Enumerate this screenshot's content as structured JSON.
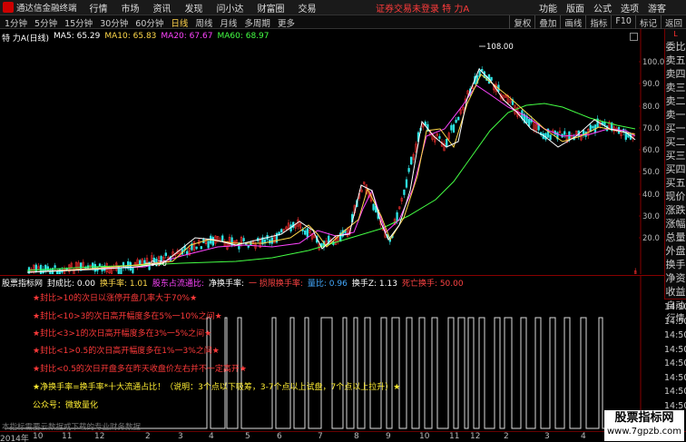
{
  "menubar": {
    "app_name": "通达信金融终端",
    "items": [
      "行情",
      "市场",
      "资讯",
      "发现",
      "问小达",
      "财富圈",
      "交易"
    ],
    "warning": "证券交易未登录  特 力A",
    "right_items": [
      "功能",
      "版面",
      "公式",
      "选项",
      "游客"
    ]
  },
  "toolbar": {
    "periods": [
      "1分钟",
      "5分钟",
      "15分钟",
      "30分钟",
      "60分钟",
      "日线",
      "周线",
      "月线",
      "多周期",
      "更多"
    ],
    "active_period": "日线",
    "right_buttons": [
      "复权",
      "叠加",
      "画线",
      "指标",
      "F10",
      "标记",
      "返回"
    ]
  },
  "main_chart": {
    "title": "特 力A(日线)",
    "ma5": "MA5: 65.29",
    "ma10": "MA10: 65.83",
    "ma20": "MA20: 67.67",
    "ma60": "MA60: 68.97",
    "high_label": "108.00",
    "low_label": "9.70",
    "y_ticks": [
      "100.0",
      "90.0",
      "80.0",
      "70.0",
      "60.0",
      "50.0",
      "40.0",
      "30.0",
      "20.0"
    ],
    "colors": {
      "ma5": "#ffffff",
      "ma10": "#ffd84a",
      "ma20": "#ff44ff",
      "ma60": "#44ff44"
    }
  },
  "right_panel": {
    "top": "L",
    "items": [
      "委比",
      "卖五",
      "卖四",
      "卖三",
      "卖二",
      "卖一",
      "买一",
      "买二",
      "买三",
      "买四",
      "买五",
      "现价",
      "涨跌",
      "涨幅",
      "总量",
      "外盘",
      "换手",
      "净资",
      "收益"
    ],
    "indicator_items": [
      "自动",
      "行情"
    ],
    "times": [
      "14:50",
      "14:50",
      "14:50",
      "14:50",
      "14:50",
      "14:50",
      "14:50",
      "14:50",
      "14:50"
    ]
  },
  "indicator": {
    "header_label": "股票指标网",
    "seal": "封成比: 0.00",
    "huanshou": "换手率: 1.01",
    "liutong": "股东占流通比:",
    "jing": "净换手率:",
    "jingzhi": "一 损限换手率:",
    "liangbi": "量比: 0.96",
    "hz": "换手Z: 1.13",
    "death": "死亡换手: 50.00",
    "annotations": [
      "★封比>10的次日以涨停开盘几率大于70%★",
      "★封比<10>3的次日高开幅度多在5%一10%之间★",
      "★封比<3>1的次日高开幅度多在3%一5%之间★",
      "★封比<1>0.5的次日高开幅度多在1%一3%之间★",
      "★封比<0.5的次日开盘多在昨天收盘价左右并不一定高开★",
      "★净换手率=换手率*十大流通占比！（说明：3个点以下吸筹，3-7个点以上试盘，7个点以上拉升）★",
      "公众号：微致量化"
    ],
    "footer_note": "本指标需要云数据或下载的专业财务数据"
  },
  "xaxis": {
    "labels": [
      "2014年",
      "10",
      "11",
      "12",
      "2",
      "3",
      "4",
      "5",
      "6",
      "7",
      "8",
      "9",
      "10",
      "11",
      "12",
      "2",
      "3",
      "4"
    ]
  },
  "watermark": {
    "line1": "股票指标网",
    "line2": "www.7gpzb.com"
  }
}
